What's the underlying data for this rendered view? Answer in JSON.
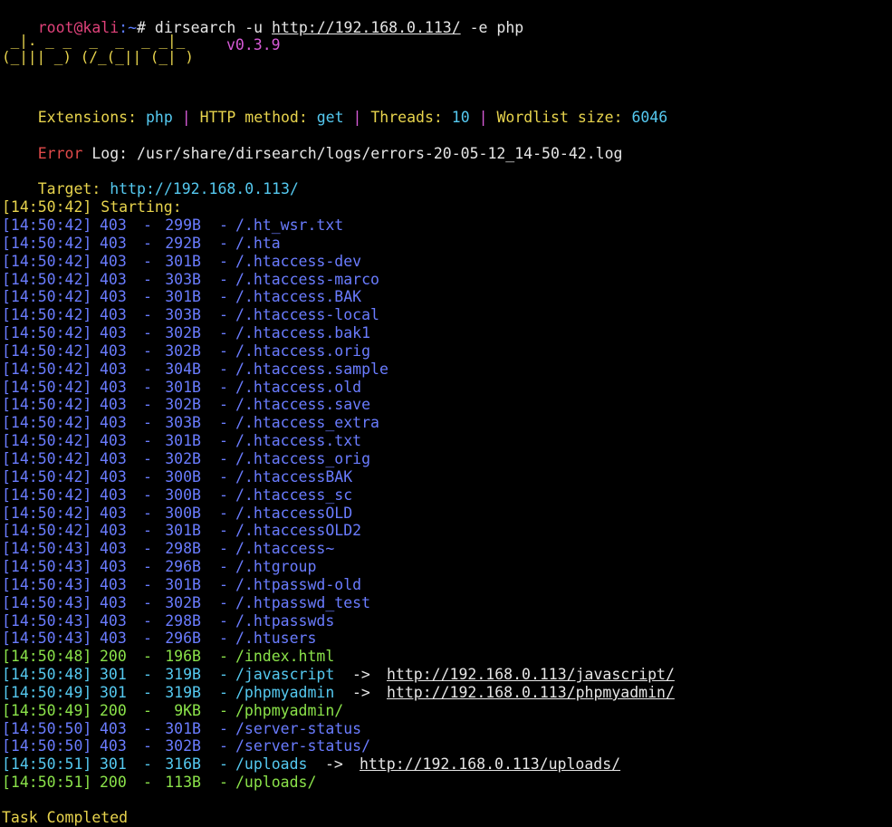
{
  "prompt": {
    "user_host": "root@kali",
    "path": ":~",
    "symbol": "# ",
    "command": "dirsearch -u ",
    "url": "http://192.168.0.113/",
    "args": " -e php"
  },
  "banner": {
    "logo_line1": " _|. _ _  _  _  _ _|_",
    "logo_line2": "(_||| _) (/_(_|| (_| )",
    "version": "v0.3.9"
  },
  "config": {
    "ext_label": "Extensions: ",
    "ext_value": "php",
    "sep1": " | ",
    "method_label": "HTTP method: ",
    "method_value": "get",
    "sep2": " | ",
    "threads_label": "Threads: ",
    "threads_value": "10",
    "sep3": " | ",
    "wordlist_label": "Wordlist size: ",
    "wordlist_value": "6046"
  },
  "errorlog": {
    "label": "Error",
    "rest": " Log: /usr/share/dirsearch/logs/errors-20-05-12_14-50-42.log"
  },
  "target": {
    "label": "Target: ",
    "value": "http://192.168.0.113/"
  },
  "starting": "[14:50:42] Starting: ",
  "results": [
    {
      "time": "[14:50:42]",
      "code": "403",
      "size": "299B",
      "path": "/.ht_wsr.txt",
      "status": "forbidden"
    },
    {
      "time": "[14:50:42]",
      "code": "403",
      "size": "292B",
      "path": "/.hta",
      "status": "forbidden"
    },
    {
      "time": "[14:50:42]",
      "code": "403",
      "size": "301B",
      "path": "/.htaccess-dev",
      "status": "forbidden"
    },
    {
      "time": "[14:50:42]",
      "code": "403",
      "size": "303B",
      "path": "/.htaccess-marco",
      "status": "forbidden"
    },
    {
      "time": "[14:50:42]",
      "code": "403",
      "size": "301B",
      "path": "/.htaccess.BAK",
      "status": "forbidden"
    },
    {
      "time": "[14:50:42]",
      "code": "403",
      "size": "303B",
      "path": "/.htaccess-local",
      "status": "forbidden"
    },
    {
      "time": "[14:50:42]",
      "code": "403",
      "size": "302B",
      "path": "/.htaccess.bak1",
      "status": "forbidden"
    },
    {
      "time": "[14:50:42]",
      "code": "403",
      "size": "302B",
      "path": "/.htaccess.orig",
      "status": "forbidden"
    },
    {
      "time": "[14:50:42]",
      "code": "403",
      "size": "304B",
      "path": "/.htaccess.sample",
      "status": "forbidden"
    },
    {
      "time": "[14:50:42]",
      "code": "403",
      "size": "301B",
      "path": "/.htaccess.old",
      "status": "forbidden"
    },
    {
      "time": "[14:50:42]",
      "code": "403",
      "size": "302B",
      "path": "/.htaccess.save",
      "status": "forbidden"
    },
    {
      "time": "[14:50:42]",
      "code": "403",
      "size": "303B",
      "path": "/.htaccess_extra",
      "status": "forbidden"
    },
    {
      "time": "[14:50:42]",
      "code": "403",
      "size": "301B",
      "path": "/.htaccess.txt",
      "status": "forbidden"
    },
    {
      "time": "[14:50:42]",
      "code": "403",
      "size": "302B",
      "path": "/.htaccess_orig",
      "status": "forbidden"
    },
    {
      "time": "[14:50:42]",
      "code": "403",
      "size": "300B",
      "path": "/.htaccessBAK",
      "status": "forbidden"
    },
    {
      "time": "[14:50:42]",
      "code": "403",
      "size": "300B",
      "path": "/.htaccess_sc",
      "status": "forbidden"
    },
    {
      "time": "[14:50:42]",
      "code": "403",
      "size": "300B",
      "path": "/.htaccessOLD",
      "status": "forbidden"
    },
    {
      "time": "[14:50:42]",
      "code": "403",
      "size": "301B",
      "path": "/.htaccessOLD2",
      "status": "forbidden"
    },
    {
      "time": "[14:50:43]",
      "code": "403",
      "size": "298B",
      "path": "/.htaccess~",
      "status": "forbidden"
    },
    {
      "time": "[14:50:43]",
      "code": "403",
      "size": "296B",
      "path": "/.htgroup",
      "status": "forbidden"
    },
    {
      "time": "[14:50:43]",
      "code": "403",
      "size": "301B",
      "path": "/.htpasswd-old",
      "status": "forbidden"
    },
    {
      "time": "[14:50:43]",
      "code": "403",
      "size": "302B",
      "path": "/.htpasswd_test",
      "status": "forbidden"
    },
    {
      "time": "[14:50:43]",
      "code": "403",
      "size": "298B",
      "path": "/.htpasswds",
      "status": "forbidden"
    },
    {
      "time": "[14:50:43]",
      "code": "403",
      "size": "296B",
      "path": "/.htusers",
      "status": "forbidden"
    },
    {
      "time": "[14:50:48]",
      "code": "200",
      "size": "196B",
      "path": "/index.html",
      "status": "ok"
    },
    {
      "time": "[14:50:48]",
      "code": "301",
      "size": "319B",
      "path": "/javascript  ",
      "arrow": "->",
      "redirect": "http://192.168.0.113/javascript/",
      "status": "redirect"
    },
    {
      "time": "[14:50:49]",
      "code": "301",
      "size": "319B",
      "path": "/phpmyadmin  ",
      "arrow": "->",
      "redirect": "http://192.168.0.113/phpmyadmin/",
      "status": "redirect"
    },
    {
      "time": "[14:50:49]",
      "code": "200",
      "size": "9KB",
      "path": "/phpmyadmin/",
      "status": "ok"
    },
    {
      "time": "[14:50:50]",
      "code": "403",
      "size": "301B",
      "path": "/server-status",
      "status": "forbidden"
    },
    {
      "time": "[14:50:50]",
      "code": "403",
      "size": "302B",
      "path": "/server-status/",
      "status": "forbidden"
    },
    {
      "time": "[14:50:51]",
      "code": "301",
      "size": "316B",
      "path": "/uploads  ",
      "arrow": "->",
      "redirect": "http://192.168.0.113/uploads/",
      "status": "redirect"
    },
    {
      "time": "[14:50:51]",
      "code": "200",
      "size": "113B",
      "path": "/uploads/",
      "status": "ok"
    }
  ],
  "completed": "Task Completed",
  "colors": {
    "forbidden": "#6a7cff",
    "ok": "#8be34a",
    "redirect": "#55c9f0",
    "prompt_user": "#e0427a",
    "accent_yellow": "#e8d44d"
  }
}
